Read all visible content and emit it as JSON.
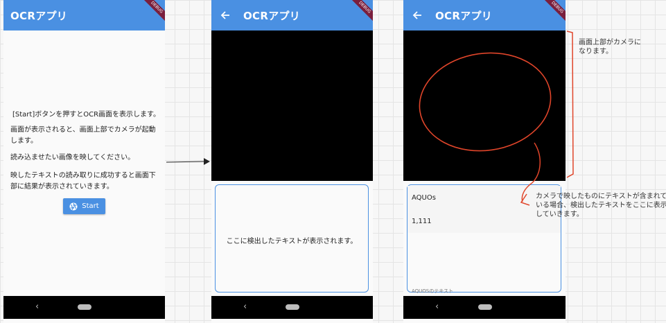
{
  "app_title": "OCRアプリ",
  "debug_ribbon": "DEBUG",
  "screen1": {
    "line1": "[Start]ボタンを押すとOCR画面を表示します。",
    "line2": "画面が表示されると、画面上部でカメラが起動します。",
    "line3": "読み込ませたい画像を映してください。",
    "line4": "映したテキストの読み取りに成功すると画面下部に結果が表示されていきます。",
    "start_label": "Start",
    "start_icon": "camera-shutter-icon"
  },
  "screen2": {
    "placeholder": "ここに検出したテキストが表示されます。"
  },
  "screen3": {
    "results": [
      "AQUOs",
      "1,111"
    ],
    "cutoff_text": "AQUOSのテキスト"
  },
  "navigation": {
    "back_glyph": "‹",
    "back_icon": "nav-back-icon",
    "home_icon": "nav-home-pill-icon"
  },
  "annotations": {
    "camera_note": "画面上部がカメラになります。",
    "result_note": "カメラで映したものにテキストが含まれている場合、検出したテキストをここに表示していきます。"
  },
  "colors": {
    "appbar": "#4a90e2",
    "annotation_red": "#e0452a",
    "ribbon": "#7a1f3d",
    "camera": "#000000"
  }
}
